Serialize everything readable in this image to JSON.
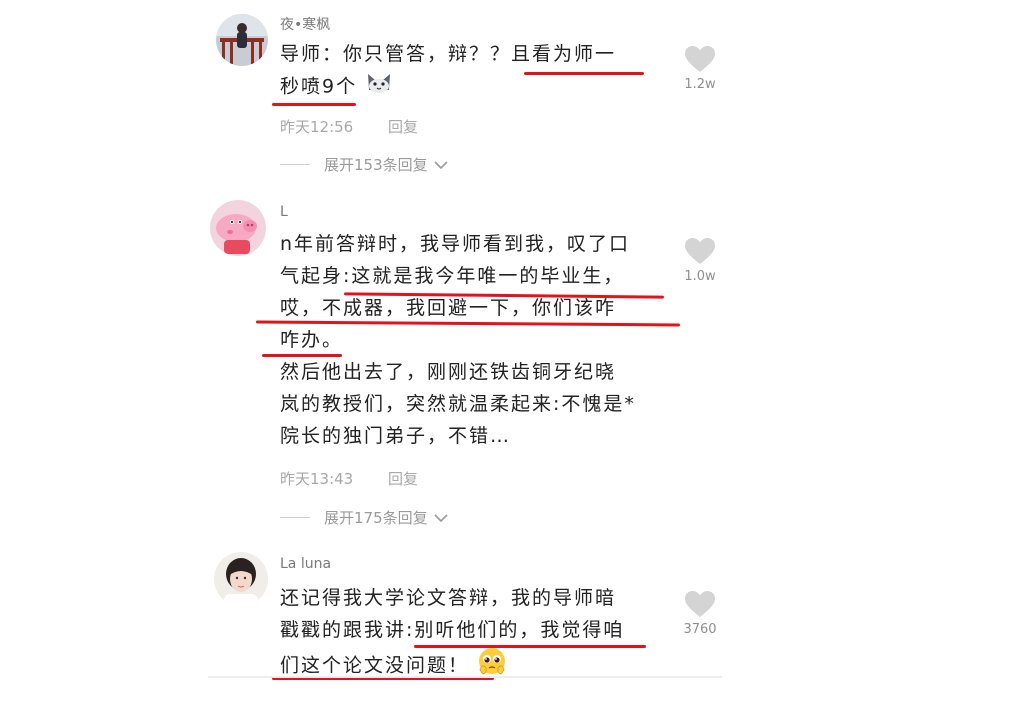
{
  "comments": [
    {
      "username": "夜•寒枫",
      "lines": [
        "导师：你只管答，辩？？且看为师一",
        "秒喷9个"
      ],
      "time": "昨天12:56",
      "reply_label": "回复",
      "expand_label": "展开153条回复",
      "like_count": "1.2w",
      "avatar": "person-on-balcony"
    },
    {
      "username": "L",
      "lines": [
        "n年前答辩时，我导师看到我，叹了口",
        "气起身:这就是我今年唯一的毕业生，",
        "哎，不成器，我回避一下，你们该咋",
        "咋办。",
        "然后他出去了，刚刚还铁齿铜牙纪晓",
        "岚的教授们，突然就温柔起来:不愧是*",
        "院长的独门弟子，不错…"
      ],
      "time": "昨天13:43",
      "reply_label": "回复",
      "expand_label": "展开175条回复",
      "like_count": "1.0w",
      "avatar": "peppa-pig"
    },
    {
      "username": "La luna",
      "lines": [
        "还记得我大学论文答辩，我的导师暗",
        "戳戳的跟我讲:别听他们的，我觉得咱",
        "们这个论文没问题！"
      ],
      "like_count": "3760",
      "avatar": "girl-portrait"
    }
  ],
  "colors": {
    "underline": "#e1141c",
    "heart": "#d4d4d4"
  }
}
